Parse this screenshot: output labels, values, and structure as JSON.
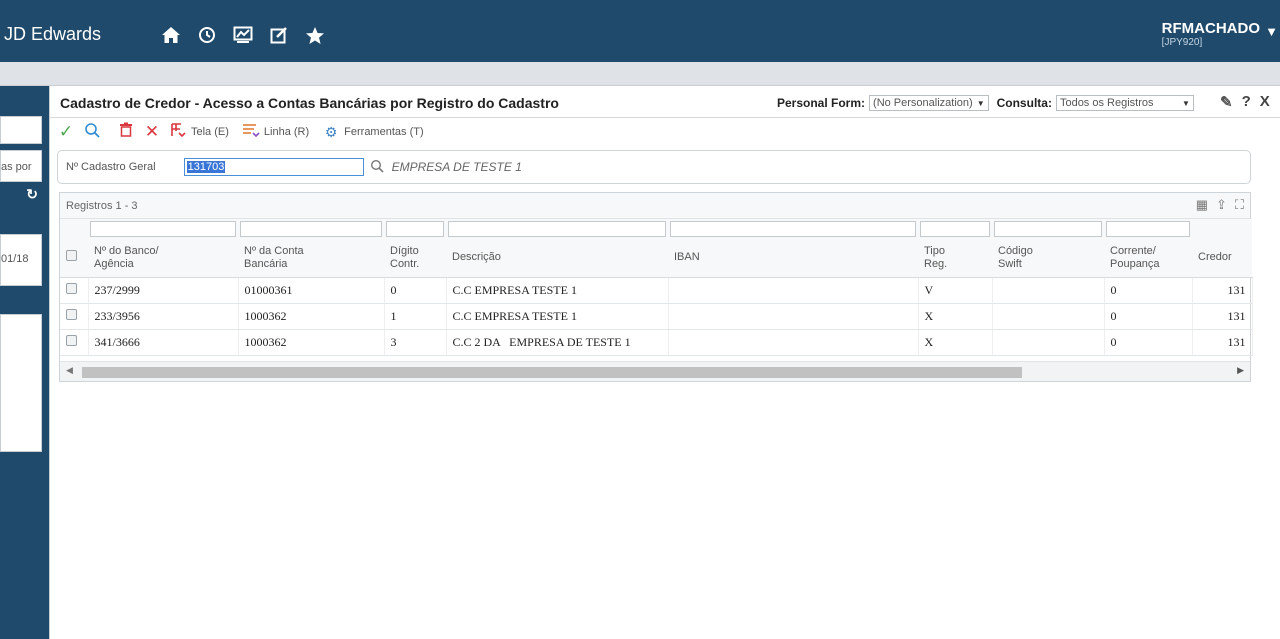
{
  "topbar": {
    "app_title": "JD Edwards",
    "icons": [
      "home-icon",
      "recent-icon",
      "dashboard-icon",
      "edit-icon",
      "favorites-icon"
    ],
    "user_name": "RFMACHADO",
    "user_env": "[JPY920]"
  },
  "rail": {
    "card1_text": "as por",
    "card3_text": "↻",
    "card4_text": "01/18"
  },
  "form": {
    "title": "Cadastro de Credor - Acesso a Contas Bancárias por Registro do Cadastro",
    "personal_form_label": "Personal Form:",
    "personal_form_value": "(No Personalization)",
    "consulta_label": "Consulta:",
    "consulta_value": "Todos os Registros"
  },
  "toolbar": {
    "tela_label": "Tela (E)",
    "linha_label": "Linha (R)",
    "ferramentas_label": "Ferramentas (T)"
  },
  "criteria": {
    "label": "Nº Cadastro Geral",
    "value": "131703",
    "description": "EMPRESA DE TESTE 1"
  },
  "grid": {
    "count_label": "Registros 1 - 3",
    "columns": [
      {
        "l1": "Nº do Banco/",
        "l2": "Agência"
      },
      {
        "l1": "Nº da Conta",
        "l2": "Bancária"
      },
      {
        "l1": "Dígito",
        "l2": "Contr."
      },
      {
        "l1": "Descrição",
        "l2": ""
      },
      {
        "l1": "IBAN",
        "l2": ""
      },
      {
        "l1": "Tipo",
        "l2": "Reg."
      },
      {
        "l1": "Código",
        "l2": "Swift"
      },
      {
        "l1": "Corrente/",
        "l2": "Poupança"
      },
      {
        "l1": "Credor",
        "l2": ""
      }
    ],
    "rows": [
      [
        "237/2999",
        "01000361",
        "0",
        "C.C EMPRESA TESTE 1",
        "",
        "V",
        "",
        "0",
        "131"
      ],
      [
        "233/3956",
        "1000362",
        "1",
        "C.C EMPRESA TESTE 1",
        "",
        "X",
        "",
        "0",
        "131"
      ],
      [
        "341/3666",
        "1000362",
        "3",
        "C.C 2 DA   EMPRESA DE TESTE 1",
        "",
        "X",
        "",
        "0",
        "131"
      ]
    ]
  }
}
